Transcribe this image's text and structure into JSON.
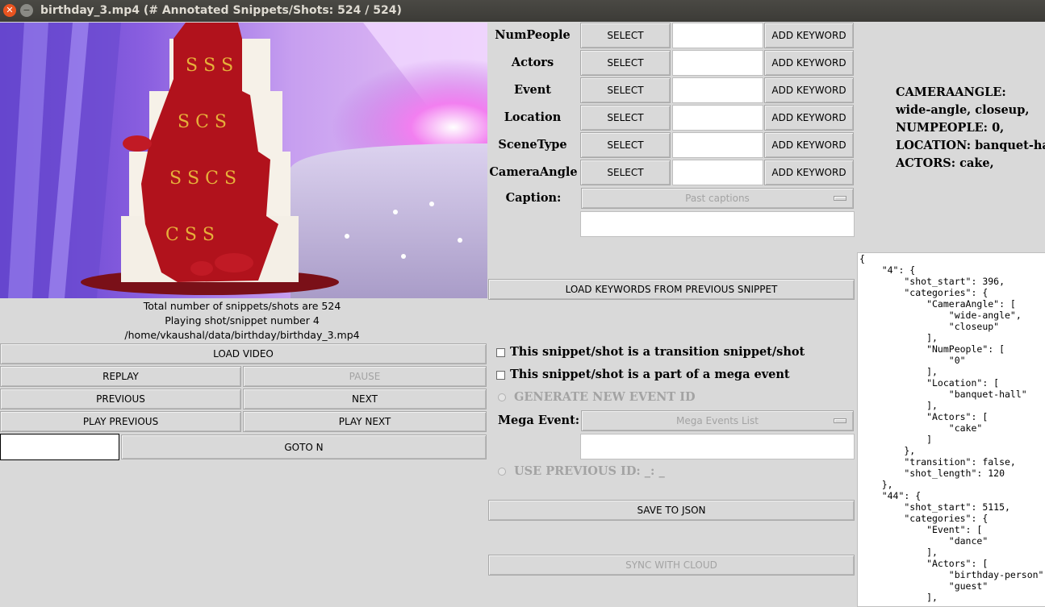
{
  "window": {
    "title": "birthday_3.mp4 (# Annotated Snippets/Shots: 524 / 524)"
  },
  "icons": {
    "close": "close-icon",
    "minimize": "minimize-icon"
  },
  "info": {
    "line1": "Total number of snippets/shots are 524",
    "line2": "Playing shot/snippet number 4",
    "line3": "/home/vkaushal/data/birthday/birthday_3.mp4"
  },
  "left_buttons": {
    "load_video": "LOAD VIDEO",
    "replay": "REPLAY",
    "pause": "PAUSE",
    "previous": "PREVIOUS",
    "next": "NEXT",
    "play_previous": "PLAY PREVIOUS",
    "play_next": "PLAY NEXT",
    "goto_value": "",
    "goto_n": "GOTO N"
  },
  "categories": [
    {
      "label": "NumPeople",
      "select": "SELECT",
      "add": "ADD KEYWORD",
      "value": ""
    },
    {
      "label": "Actors",
      "select": "SELECT",
      "add": "ADD KEYWORD",
      "value": ""
    },
    {
      "label": "Event",
      "select": "SELECT",
      "add": "ADD KEYWORD",
      "value": ""
    },
    {
      "label": "Location",
      "select": "SELECT",
      "add": "ADD KEYWORD",
      "value": ""
    },
    {
      "label": "SceneType",
      "select": "SELECT",
      "add": "ADD KEYWORD",
      "value": ""
    },
    {
      "label": "CameraAngle",
      "select": "SELECT",
      "add": "ADD KEYWORD",
      "value": ""
    }
  ],
  "caption": {
    "label": "Caption:",
    "dropdown": "Past captions",
    "value": ""
  },
  "load_keywords": "LOAD KEYWORDS FROM PREVIOUS SNIPPET",
  "checkboxes": {
    "transition": "This snippet/shot is a transition snippet/shot",
    "mega": "This snippet/shot is a part of a mega event"
  },
  "generate_event": "GENERATE NEW EVENT ID",
  "mega_event": {
    "label": "Mega Event:",
    "dropdown": "Mega Events List",
    "value": ""
  },
  "use_previous": "USE PREVIOUS ID: _: _",
  "save_json": "SAVE TO JSON",
  "sync_cloud": "SYNC WITH CLOUD",
  "summary": {
    "l1": "CAMERAANGLE:",
    "l2": "wide-angle, closeup,",
    "l3": "NUMPEOPLE: 0,",
    "l4": "LOCATION: banquet-hall,",
    "l5": "ACTORS: cake,"
  },
  "json_text": "{\n    \"4\": {\n        \"shot_start\": 396,\n        \"categories\": {\n            \"CameraAngle\": [\n                \"wide-angle\",\n                \"closeup\"\n            ],\n            \"NumPeople\": [\n                \"0\"\n            ],\n            \"Location\": [\n                \"banquet-hall\"\n            ],\n            \"Actors\": [\n                \"cake\"\n            ]\n        },\n        \"transition\": false,\n        \"shot_length\": 120\n    },\n    \"44\": {\n        \"shot_start\": 5115,\n        \"categories\": {\n            \"Event\": [\n                \"dance\"\n            ],\n            \"Actors\": [\n                \"birthday-person\",\n                \"guest\"\n            ],"
}
